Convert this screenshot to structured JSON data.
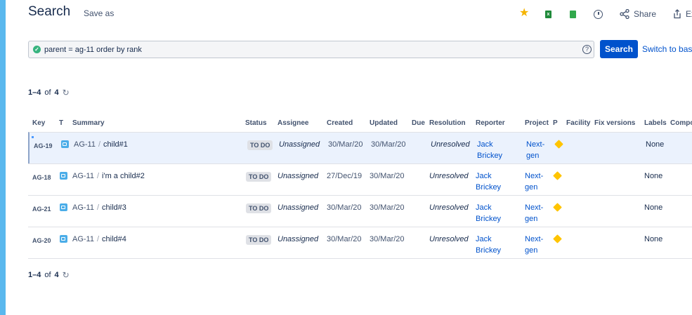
{
  "page": {
    "title": "Search",
    "save_as": "Save as",
    "share_label": "Share",
    "export_label": "Ex"
  },
  "jql": {
    "query": "parent = ag-11 order by rank",
    "help": "?",
    "search_button": "Search",
    "switch_link": "Switch to basic"
  },
  "pager_top": {
    "range": "1–4",
    "of": "of",
    "total": "4"
  },
  "pager_bottom": {
    "range": "1–4",
    "of": "of",
    "total": "4"
  },
  "columns": {
    "key": "Key",
    "type": "T",
    "summary": "Summary",
    "status": "Status",
    "assignee": "Assignee",
    "created": "Created",
    "updated": "Updated",
    "due": "Due",
    "resolution": "Resolution",
    "reporter": "Reporter",
    "project": "Project",
    "priority": "P",
    "facility": "Facility",
    "fix_versions": "Fix versions",
    "labels": "Labels",
    "components": "Compo"
  },
  "rows": [
    {
      "key": "AG-19",
      "parent": "AG-11",
      "summary": "child#1",
      "status": "TO DO",
      "assignee": "Unassigned",
      "created": "30/Mar/20",
      "updated": "30/Mar/20",
      "resolution": "Unresolved",
      "reporter_first": "Jack",
      "reporter_last": "Brickey",
      "project_line1": "Next-",
      "project_line2": "gen",
      "labels": "None"
    },
    {
      "key": "AG-18",
      "parent": "AG-11",
      "summary": "i'm a child#2",
      "status": "TO DO",
      "assignee": "Unassigned",
      "created": "27/Dec/19",
      "updated": "30/Mar/20",
      "resolution": "Unresolved",
      "reporter_first": "Jack",
      "reporter_last": "Brickey",
      "project_line1": "Next-",
      "project_line2": "gen",
      "labels": "None"
    },
    {
      "key": "AG-21",
      "parent": "AG-11",
      "summary": "child#3",
      "status": "TO DO",
      "assignee": "Unassigned",
      "created": "30/Mar/20",
      "updated": "30/Mar/20",
      "resolution": "Unresolved",
      "reporter_first": "Jack",
      "reporter_last": "Brickey",
      "project_line1": "Next-",
      "project_line2": "gen",
      "labels": "None"
    },
    {
      "key": "AG-20",
      "parent": "AG-11",
      "summary": "child#4",
      "status": "TO DO",
      "assignee": "Unassigned",
      "created": "30/Mar/20",
      "updated": "30/Mar/20",
      "resolution": "Unresolved",
      "reporter_first": "Jack",
      "reporter_last": "Brickey",
      "project_line1": "Next-",
      "project_line2": "gen",
      "labels": "None"
    }
  ],
  "colors": {
    "accent": "#0052cc",
    "strip": "#5ab8ee",
    "star": "#f5b400",
    "priority": "#ffc400",
    "selected_row": "#ebf2fd"
  },
  "icons": {
    "star": "star-icon",
    "excel": "excel-export-icon",
    "csv": "csv-export-icon",
    "clock": "history-icon",
    "share": "share-icon",
    "export": "export-icon",
    "ok": "valid-query-icon",
    "refresh": "refresh-icon",
    "type": "subtask-icon",
    "priority": "priority-medium-icon"
  }
}
